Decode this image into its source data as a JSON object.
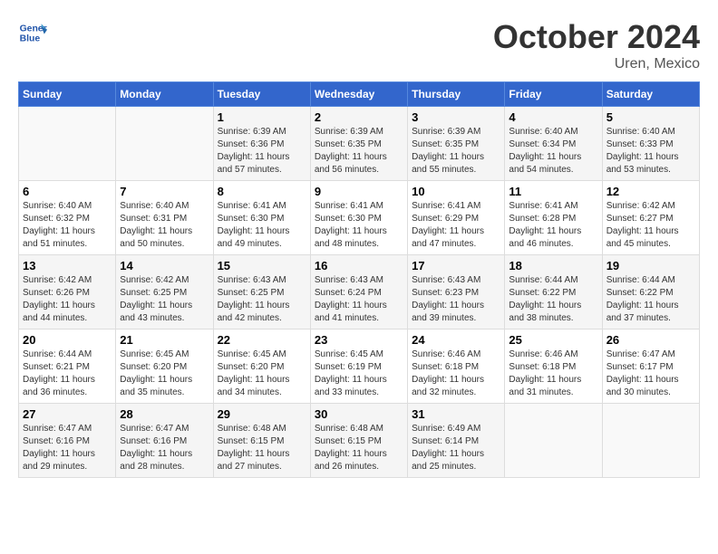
{
  "header": {
    "logo_general": "General",
    "logo_blue": "Blue",
    "month_title": "October 2024",
    "location": "Uren, Mexico"
  },
  "weekdays": [
    "Sunday",
    "Monday",
    "Tuesday",
    "Wednesday",
    "Thursday",
    "Friday",
    "Saturday"
  ],
  "weeks": [
    [
      null,
      null,
      {
        "day": "1",
        "sunrise": "Sunrise: 6:39 AM",
        "sunset": "Sunset: 6:36 PM",
        "daylight": "Daylight: 11 hours and 57 minutes."
      },
      {
        "day": "2",
        "sunrise": "Sunrise: 6:39 AM",
        "sunset": "Sunset: 6:35 PM",
        "daylight": "Daylight: 11 hours and 56 minutes."
      },
      {
        "day": "3",
        "sunrise": "Sunrise: 6:39 AM",
        "sunset": "Sunset: 6:35 PM",
        "daylight": "Daylight: 11 hours and 55 minutes."
      },
      {
        "day": "4",
        "sunrise": "Sunrise: 6:40 AM",
        "sunset": "Sunset: 6:34 PM",
        "daylight": "Daylight: 11 hours and 54 minutes."
      },
      {
        "day": "5",
        "sunrise": "Sunrise: 6:40 AM",
        "sunset": "Sunset: 6:33 PM",
        "daylight": "Daylight: 11 hours and 53 minutes."
      }
    ],
    [
      {
        "day": "6",
        "sunrise": "Sunrise: 6:40 AM",
        "sunset": "Sunset: 6:32 PM",
        "daylight": "Daylight: 11 hours and 51 minutes."
      },
      {
        "day": "7",
        "sunrise": "Sunrise: 6:40 AM",
        "sunset": "Sunset: 6:31 PM",
        "daylight": "Daylight: 11 hours and 50 minutes."
      },
      {
        "day": "8",
        "sunrise": "Sunrise: 6:41 AM",
        "sunset": "Sunset: 6:30 PM",
        "daylight": "Daylight: 11 hours and 49 minutes."
      },
      {
        "day": "9",
        "sunrise": "Sunrise: 6:41 AM",
        "sunset": "Sunset: 6:30 PM",
        "daylight": "Daylight: 11 hours and 48 minutes."
      },
      {
        "day": "10",
        "sunrise": "Sunrise: 6:41 AM",
        "sunset": "Sunset: 6:29 PM",
        "daylight": "Daylight: 11 hours and 47 minutes."
      },
      {
        "day": "11",
        "sunrise": "Sunrise: 6:41 AM",
        "sunset": "Sunset: 6:28 PM",
        "daylight": "Daylight: 11 hours and 46 minutes."
      },
      {
        "day": "12",
        "sunrise": "Sunrise: 6:42 AM",
        "sunset": "Sunset: 6:27 PM",
        "daylight": "Daylight: 11 hours and 45 minutes."
      }
    ],
    [
      {
        "day": "13",
        "sunrise": "Sunrise: 6:42 AM",
        "sunset": "Sunset: 6:26 PM",
        "daylight": "Daylight: 11 hours and 44 minutes."
      },
      {
        "day": "14",
        "sunrise": "Sunrise: 6:42 AM",
        "sunset": "Sunset: 6:25 PM",
        "daylight": "Daylight: 11 hours and 43 minutes."
      },
      {
        "day": "15",
        "sunrise": "Sunrise: 6:43 AM",
        "sunset": "Sunset: 6:25 PM",
        "daylight": "Daylight: 11 hours and 42 minutes."
      },
      {
        "day": "16",
        "sunrise": "Sunrise: 6:43 AM",
        "sunset": "Sunset: 6:24 PM",
        "daylight": "Daylight: 11 hours and 41 minutes."
      },
      {
        "day": "17",
        "sunrise": "Sunrise: 6:43 AM",
        "sunset": "Sunset: 6:23 PM",
        "daylight": "Daylight: 11 hours and 39 minutes."
      },
      {
        "day": "18",
        "sunrise": "Sunrise: 6:44 AM",
        "sunset": "Sunset: 6:22 PM",
        "daylight": "Daylight: 11 hours and 38 minutes."
      },
      {
        "day": "19",
        "sunrise": "Sunrise: 6:44 AM",
        "sunset": "Sunset: 6:22 PM",
        "daylight": "Daylight: 11 hours and 37 minutes."
      }
    ],
    [
      {
        "day": "20",
        "sunrise": "Sunrise: 6:44 AM",
        "sunset": "Sunset: 6:21 PM",
        "daylight": "Daylight: 11 hours and 36 minutes."
      },
      {
        "day": "21",
        "sunrise": "Sunrise: 6:45 AM",
        "sunset": "Sunset: 6:20 PM",
        "daylight": "Daylight: 11 hours and 35 minutes."
      },
      {
        "day": "22",
        "sunrise": "Sunrise: 6:45 AM",
        "sunset": "Sunset: 6:20 PM",
        "daylight": "Daylight: 11 hours and 34 minutes."
      },
      {
        "day": "23",
        "sunrise": "Sunrise: 6:45 AM",
        "sunset": "Sunset: 6:19 PM",
        "daylight": "Daylight: 11 hours and 33 minutes."
      },
      {
        "day": "24",
        "sunrise": "Sunrise: 6:46 AM",
        "sunset": "Sunset: 6:18 PM",
        "daylight": "Daylight: 11 hours and 32 minutes."
      },
      {
        "day": "25",
        "sunrise": "Sunrise: 6:46 AM",
        "sunset": "Sunset: 6:18 PM",
        "daylight": "Daylight: 11 hours and 31 minutes."
      },
      {
        "day": "26",
        "sunrise": "Sunrise: 6:47 AM",
        "sunset": "Sunset: 6:17 PM",
        "daylight": "Daylight: 11 hours and 30 minutes."
      }
    ],
    [
      {
        "day": "27",
        "sunrise": "Sunrise: 6:47 AM",
        "sunset": "Sunset: 6:16 PM",
        "daylight": "Daylight: 11 hours and 29 minutes."
      },
      {
        "day": "28",
        "sunrise": "Sunrise: 6:47 AM",
        "sunset": "Sunset: 6:16 PM",
        "daylight": "Daylight: 11 hours and 28 minutes."
      },
      {
        "day": "29",
        "sunrise": "Sunrise: 6:48 AM",
        "sunset": "Sunset: 6:15 PM",
        "daylight": "Daylight: 11 hours and 27 minutes."
      },
      {
        "day": "30",
        "sunrise": "Sunrise: 6:48 AM",
        "sunset": "Sunset: 6:15 PM",
        "daylight": "Daylight: 11 hours and 26 minutes."
      },
      {
        "day": "31",
        "sunrise": "Sunrise: 6:49 AM",
        "sunset": "Sunset: 6:14 PM",
        "daylight": "Daylight: 11 hours and 25 minutes."
      },
      null,
      null
    ]
  ]
}
